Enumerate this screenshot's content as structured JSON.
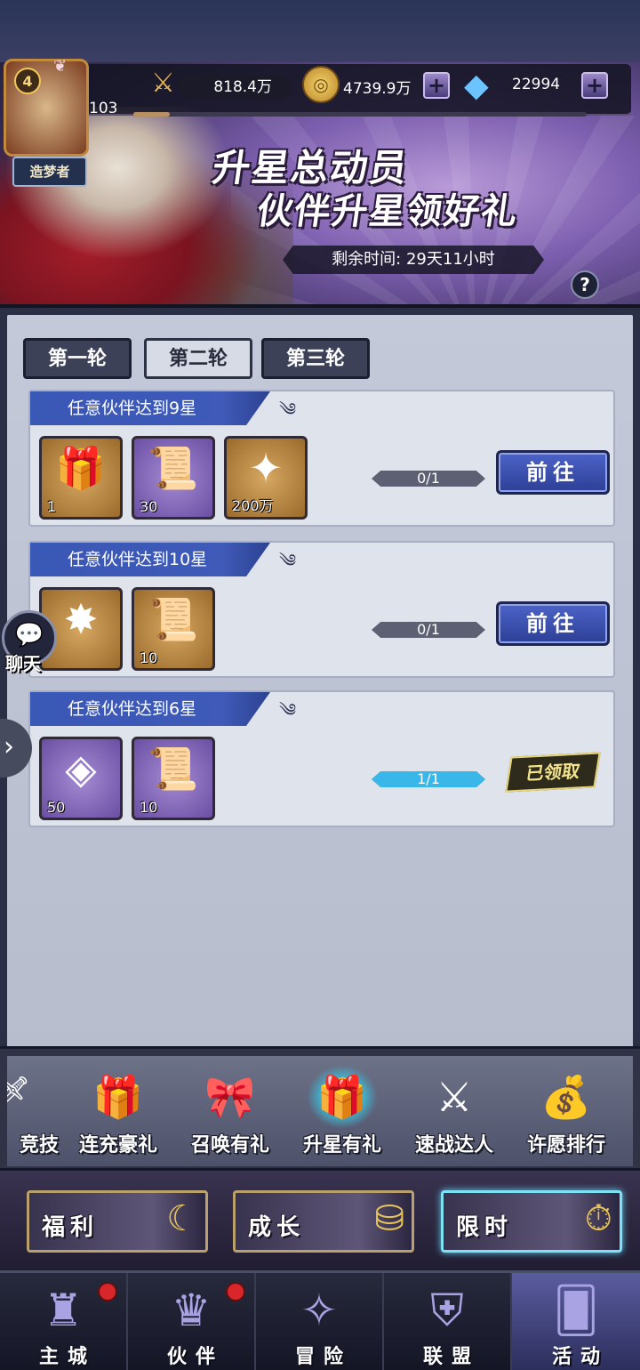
{
  "header": {
    "player_level": "4",
    "avatar_exp_level": "103",
    "title_badge": "造梦者",
    "power": "818.4万",
    "gold": "4739.9万",
    "gems": "22994"
  },
  "banner": {
    "title_line1": "升星总动员",
    "title_line2": "伙伴升星领好礼",
    "time_remaining": "剩余时间: 29天11小时"
  },
  "tabs": [
    {
      "label": "第一轮",
      "active": false
    },
    {
      "label": "第二轮",
      "active": true
    },
    {
      "label": "第三轮",
      "active": false
    }
  ],
  "tasks": [
    {
      "title": "任意伙伴达到9星",
      "rewards": [
        {
          "icon": "gift-box-icon",
          "count": "1"
        },
        {
          "icon": "blue-scroll-icon",
          "count": "30"
        },
        {
          "icon": "exp-star-icon",
          "count": "200万"
        }
      ],
      "progress": "0/1",
      "progress_fraction": 0,
      "action": "前往",
      "status": "go"
    },
    {
      "title": "任意伙伴达到10星",
      "rewards": [
        {
          "icon": "gold-sigil-icon",
          "count": ""
        },
        {
          "icon": "orange-scroll-icon",
          "count": "10"
        }
      ],
      "progress": "0/1",
      "progress_fraction": 0,
      "action": "前往",
      "status": "go"
    },
    {
      "title": "任意伙伴达到6星",
      "rewards": [
        {
          "icon": "gold-crystal-icon",
          "count": "50"
        },
        {
          "icon": "blue-scroll-icon",
          "count": "10"
        }
      ],
      "progress": "1/1",
      "progress_fraction": 1,
      "action": "已领取",
      "status": "claimed"
    }
  ],
  "chat": {
    "label": "聊天"
  },
  "activities": [
    {
      "label": "竞技",
      "selected": false
    },
    {
      "label": "连充豪礼",
      "selected": false
    },
    {
      "label": "召唤有礼",
      "selected": false
    },
    {
      "label": "升星有礼",
      "selected": true
    },
    {
      "label": "速战达人",
      "selected": false
    },
    {
      "label": "许愿排行",
      "selected": false
    }
  ],
  "categories": [
    {
      "label": "福利",
      "active": false
    },
    {
      "label": "成长",
      "active": false
    },
    {
      "label": "限时",
      "active": true
    }
  ],
  "nav": [
    {
      "label": "主城",
      "badge": true
    },
    {
      "label": "伙伴",
      "badge": true
    },
    {
      "label": "冒险",
      "badge": false
    },
    {
      "label": "联盟",
      "badge": false
    },
    {
      "label": "活动",
      "badge": false,
      "active": true
    }
  ],
  "colors": {
    "accent_blue": "#3a58b6",
    "progress_fill": "#38b7e8",
    "claimed_gold": "#f3e48b",
    "badge_red": "#d8262a"
  }
}
